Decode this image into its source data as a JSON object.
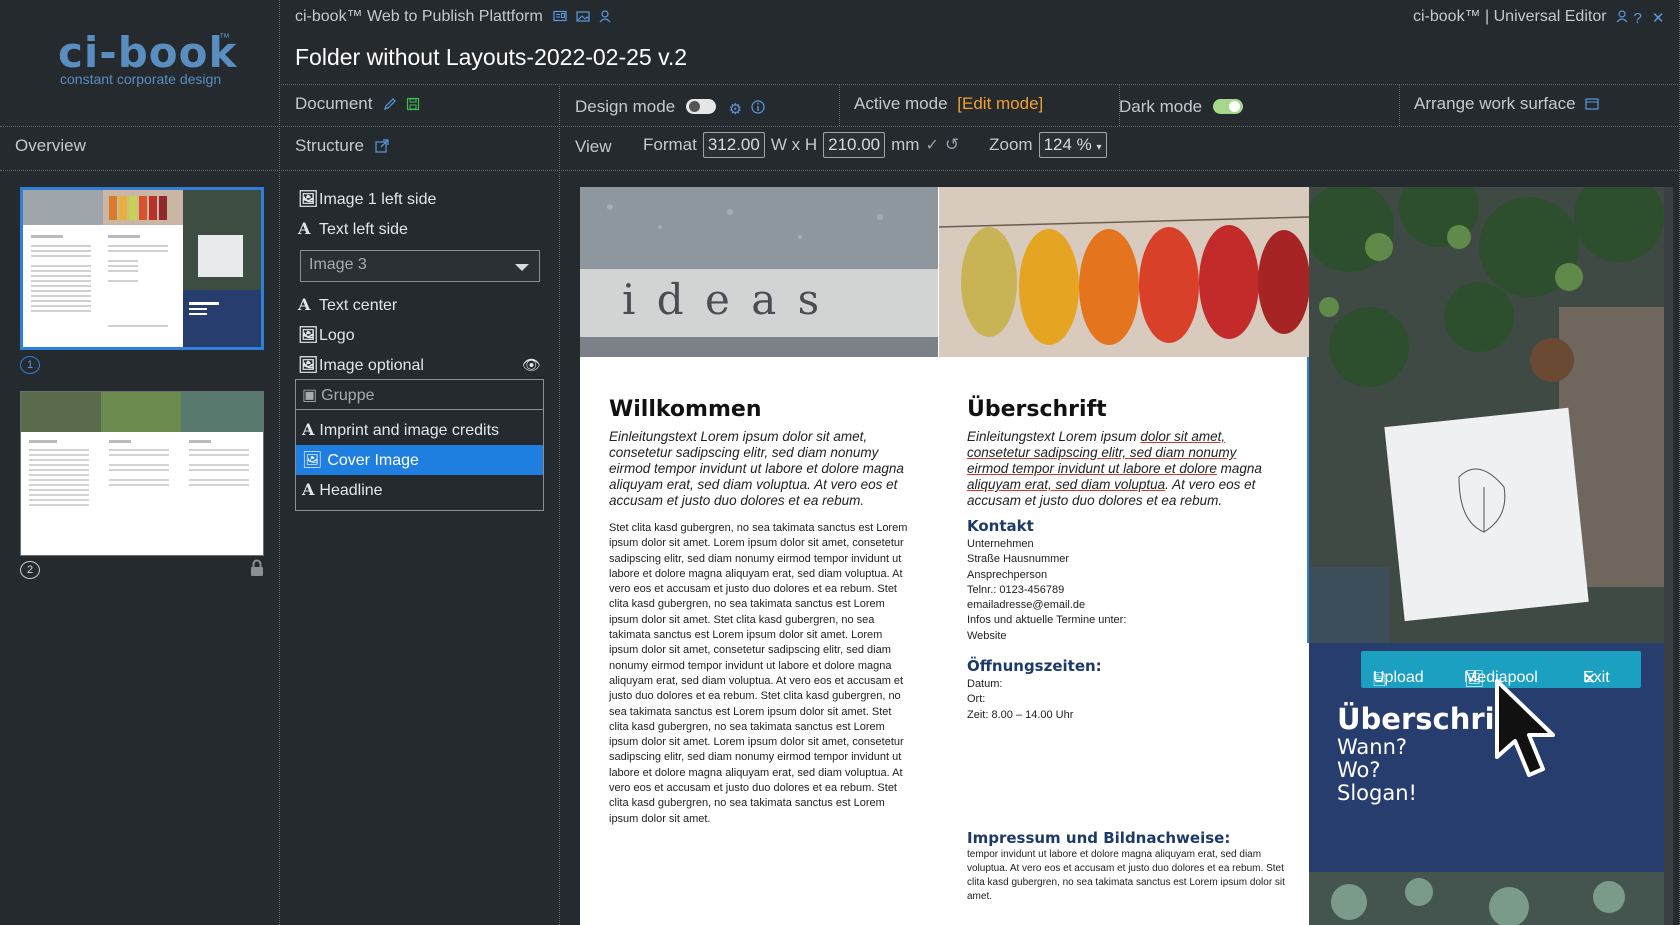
{
  "brand": {
    "logo_word": "ci-book",
    "logo_tm": "™",
    "tagline": "constant corporate design"
  },
  "topbar": {
    "left_title": "ci-book™ Web to Publish Plattform",
    "right_title": "ci-book™ | Universal Editor"
  },
  "document_title": "Folder without Layouts-2022-02-25 v.2",
  "toolbar_row": {
    "document_label": "Document",
    "design_mode_label": "Design mode",
    "active_mode_label": "Active mode",
    "active_mode_value": "[Edit mode]",
    "dark_mode_label": "Dark mode",
    "arrange_label": "Arrange work surface",
    "design_mode_on": false,
    "dark_mode_on": true
  },
  "row2": {
    "overview_label": "Overview",
    "structure_label": "Structure",
    "view_label": "View",
    "format_label": "Format",
    "width_value": "312.00",
    "wxh_label": "W x H",
    "height_value": "210.00",
    "unit_label": "mm",
    "zoom_label": "Zoom",
    "zoom_value": "124 %"
  },
  "overview": {
    "pages": [
      "1",
      "2"
    ]
  },
  "structure": {
    "items_top": [
      "Image 1 left side",
      "Text left side"
    ],
    "dropdown_value": "Image 3",
    "items_mid": [
      "Text center",
      "Logo",
      "Image optional"
    ],
    "group_label": "Gruppe",
    "group_items": [
      "Imprint and image credits",
      "Cover Image",
      "Headline"
    ],
    "selected": "Cover Image"
  },
  "page": {
    "photo_left_text": "i d e a s",
    "col1_title": "Willkommen",
    "col1_intro": "Einleitungstext Lorem ipsum dolor sit amet, consetetur sadipscing elitr, sed diam nonumy eirmod tempor invidunt ut labore et dolore magna aliquyam erat, sed diam voluptua. At vero eos et accusam et justo duo dolores et ea rebum.",
    "col1_body": "Stet clita kasd gubergren, no sea takimata sanctus est Lorem ipsum dolor sit amet. Lorem ipsum dolor sit amet, consetetur sadipscing elitr, sed diam nonumy eirmod tempor invidunt ut labore et dolore magna aliquyam erat, sed diam voluptua. At vero eos et accusam et justo duo dolores et ea rebum. Stet clita kasd gubergren, no sea takimata sanctus est Lorem ipsum dolor sit amet. Stet clita kasd gubergren, no sea takimata sanctus est Lorem ipsum dolor sit amet. Lorem ipsum dolor sit amet, consetetur sadipscing elitr, sed diam nonumy eirmod tempor invidunt ut labore et dolore magna aliquyam erat, sed diam voluptua. At vero eos et accusam et justo duo dolores et ea rebum. Stet clita kasd gubergren, no sea takimata sanctus est Lorem ipsum dolor sit amet. Stet clita kasd gubergren, no sea takimata sanctus est Lorem ipsum dolor sit amet. Lorem ipsum dolor sit amet, consetetur sadipscing elitr, sed diam nonumy eirmod tempor invidunt ut labore et dolore magna aliquyam erat, sed diam voluptua. At vero eos et accusam et justo duo dolores et ea rebum. Stet clita kasd gubergren, no sea takimata sanctus est Lorem ipsum dolor sit amet.",
    "col2_title": "Überschrift",
    "col2_intro_a": "Einleitungstext Lorem ipsum ",
    "col2_intro_b": "dolor sit amet, consetetur sadipscing elitr, sed diam nonumy eirmod tempor invidunt ut labore et dolore",
    "col2_intro_c": " magna ",
    "col2_intro_d": "aliquyam erat, sed diam voluptua",
    "col2_intro_e": ". At vero eos et accusam et justo duo dolores et ea rebum.",
    "contact_head": "Kontakt",
    "contact_lines": [
      "Unternehmen",
      "Straße Hausnummer",
      "Ansprechperson",
      "Telnr.: 0123-456789",
      "emailadresse@email.de",
      "Infos und aktuelle Termine unter:",
      "Website"
    ],
    "hours_head": "Öffnungszeiten:",
    "hours_lines": [
      "Datum:",
      "Ort:",
      "Zeit: 8.00 – 14.00 Uhr"
    ],
    "imprint_head": "Impressum und Bildnachweise:",
    "imprint_body": "tempor invidunt ut labore et dolore magna aliquyam erat, sed diam voluptua. At vero eos et accusam et justo duo dolores et ea rebum. Stet clita kasd gubergren, no sea takimata sanctus est Lorem ipsum dolor sit amet.",
    "cover_title": "Überschrift",
    "cover_lines": [
      "Wann?",
      "Wo?",
      "Slogan!"
    ]
  },
  "image_toolbar": {
    "upload": "Upload",
    "mediapool": "Mediapool",
    "exit": "Exit"
  },
  "colors": {
    "accent": "#1f7fe0",
    "edit_mode": "#f0a030",
    "panel_navy": "#263d6d",
    "toolbar_teal": "#1ba0c2"
  }
}
